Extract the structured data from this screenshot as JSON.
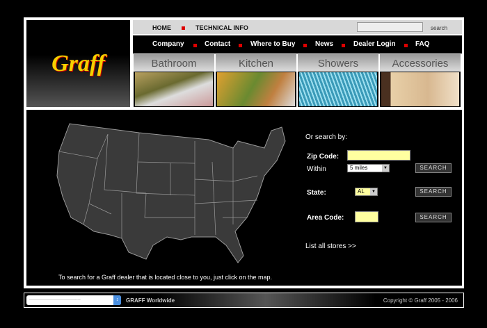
{
  "logo": "Graff",
  "topbar": {
    "home": "HOME",
    "technical": "TECHNICAL INFO",
    "search_value": "",
    "search_label": "search"
  },
  "nav": [
    "Company",
    "Contact",
    "Where to Buy",
    "News",
    "Dealer Login",
    "FAQ"
  ],
  "tabs": [
    "Bathroom",
    "Kitchen",
    "Showers",
    "Accessories"
  ],
  "search": {
    "heading": "Or search by:",
    "zip_label": "Zip Code:",
    "zip_value": "",
    "within_label": "Within",
    "within_value": "5 miles",
    "state_label": "State:",
    "state_value": "AL",
    "area_label": "Area Code:",
    "area_value": "",
    "search_btn": "SEARCH",
    "list_all": "List all stores >>"
  },
  "map_hint": "To search for a Graff dealer that is located close to you, just click on the map.",
  "footer": {
    "select_value": "-------------------------------------",
    "worldwide": "GRAFF Worldwide",
    "copyright": "Copyright © Graff 2005 - 2006"
  }
}
